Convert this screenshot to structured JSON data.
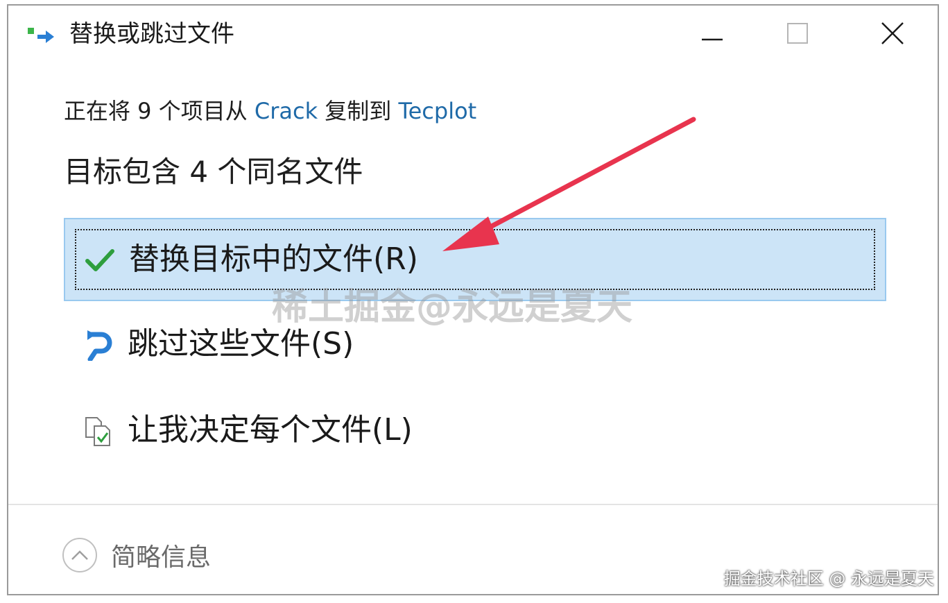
{
  "window": {
    "title": "替换或跳过文件"
  },
  "summary": {
    "prefix": "正在将 9 个项目从 ",
    "source": "Crack",
    "middle": " 复制到 ",
    "destination": "Tecplot"
  },
  "heading": "目标包含 4 个同名文件",
  "options": [
    {
      "label": "替换目标中的文件(R)",
      "icon": "checkmark-icon",
      "selected": true
    },
    {
      "label": "跳过这些文件(S)",
      "icon": "skip-arrow-icon",
      "selected": false
    },
    {
      "label": "让我决定每个文件(L)",
      "icon": "compare-files-icon",
      "selected": false
    }
  ],
  "footer": {
    "details_label": "简略信息"
  },
  "watermarks": {
    "center": "稀土掘金@永远是夏天",
    "corner": "掘金技术社区 @ 永远是夏天"
  },
  "colors": {
    "accent_link": "#1f6aa8",
    "selected_bg": "#cce4f7",
    "check_green": "#2e9e3e",
    "skip_blue": "#2a7fd4",
    "annotation_arrow": "#e8344e"
  }
}
